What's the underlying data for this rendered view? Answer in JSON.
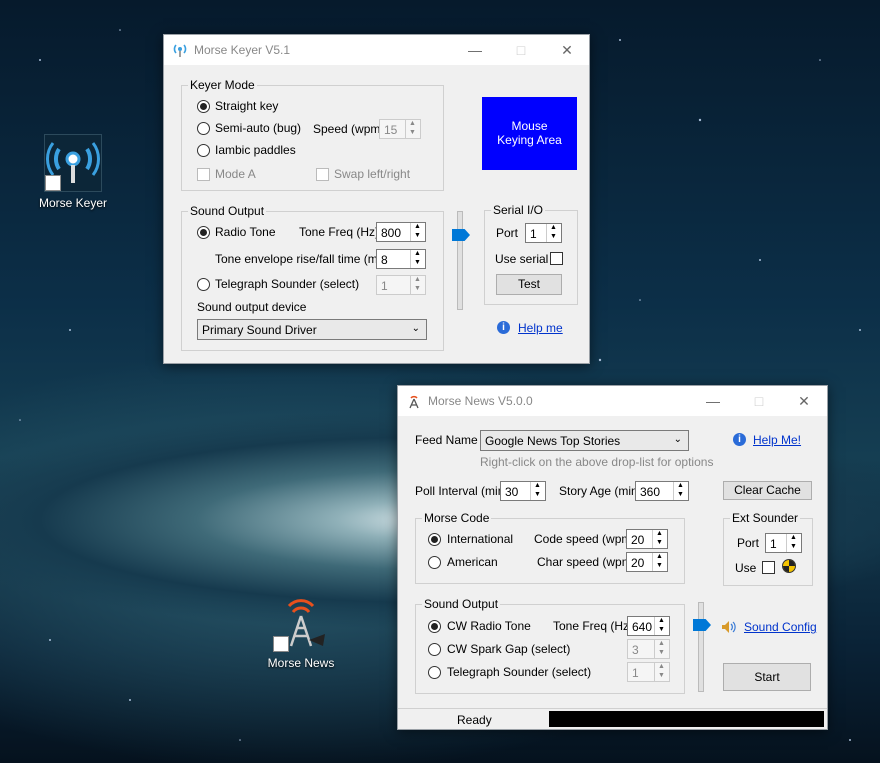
{
  "desktop": {
    "icons": [
      {
        "label": "Morse Keyer"
      },
      {
        "label": "Morse News"
      }
    ]
  },
  "keyer": {
    "title": "Morse Keyer V5.1",
    "keyer_mode": {
      "title": "Keyer Mode",
      "straight": "Straight key",
      "semiauto": "Semi-auto (bug)",
      "iambic": "Iambic paddles",
      "mode_a": "Mode A",
      "swap": "Swap left/right",
      "speed_label": "Speed (wpm)",
      "speed_value": "15"
    },
    "mouse_area": {
      "line1": "Mouse",
      "line2": "Keying Area"
    },
    "sound_output": {
      "title": "Sound Output",
      "radio_tone": "Radio Tone",
      "tone_freq_label": "Tone Freq (Hz)",
      "tone_freq_value": "800",
      "envelope_label": "Tone envelope rise/fall time (ms)",
      "envelope_value": "8",
      "telegraph": "Telegraph Sounder (select)",
      "telegraph_value": "1",
      "device_label": "Sound output device",
      "device_value": "Primary Sound Driver"
    },
    "serial": {
      "title": "Serial I/O",
      "port_label": "Port",
      "port_value": "1",
      "use_serial": "Use serial",
      "test": "Test"
    },
    "help": "Help me"
  },
  "news": {
    "title": "Morse News V5.0.0",
    "feed_label": "Feed Name",
    "feed_value": "Google News Top Stories",
    "feed_hint": "Right-click on the above drop-list for options",
    "help": "Help Me!",
    "poll_label": "Poll Interval (min)",
    "poll_value": "30",
    "age_label": "Story Age (min)",
    "age_value": "360",
    "clear_cache": "Clear Cache",
    "morse_code": {
      "title": "Morse Code",
      "international": "International",
      "american": "American",
      "code_speed_label": "Code speed (wpm)",
      "code_speed_value": "20",
      "char_speed_label": "Char speed (wpm)",
      "char_speed_value": "20"
    },
    "ext_sounder": {
      "title": "Ext Sounder",
      "port_label": "Port",
      "port_value": "1",
      "use_label": "Use"
    },
    "sound_output": {
      "title": "Sound Output",
      "cw_radio": "CW Radio Tone",
      "tone_freq_label": "Tone Freq (Hz)",
      "tone_freq_value": "640",
      "spark": "CW Spark Gap (select)",
      "spark_value": "3",
      "telegraph": "Telegraph Sounder (select)",
      "telegraph_value": "1"
    },
    "sound_config": "Sound Config",
    "start": "Start",
    "status": "Ready"
  }
}
